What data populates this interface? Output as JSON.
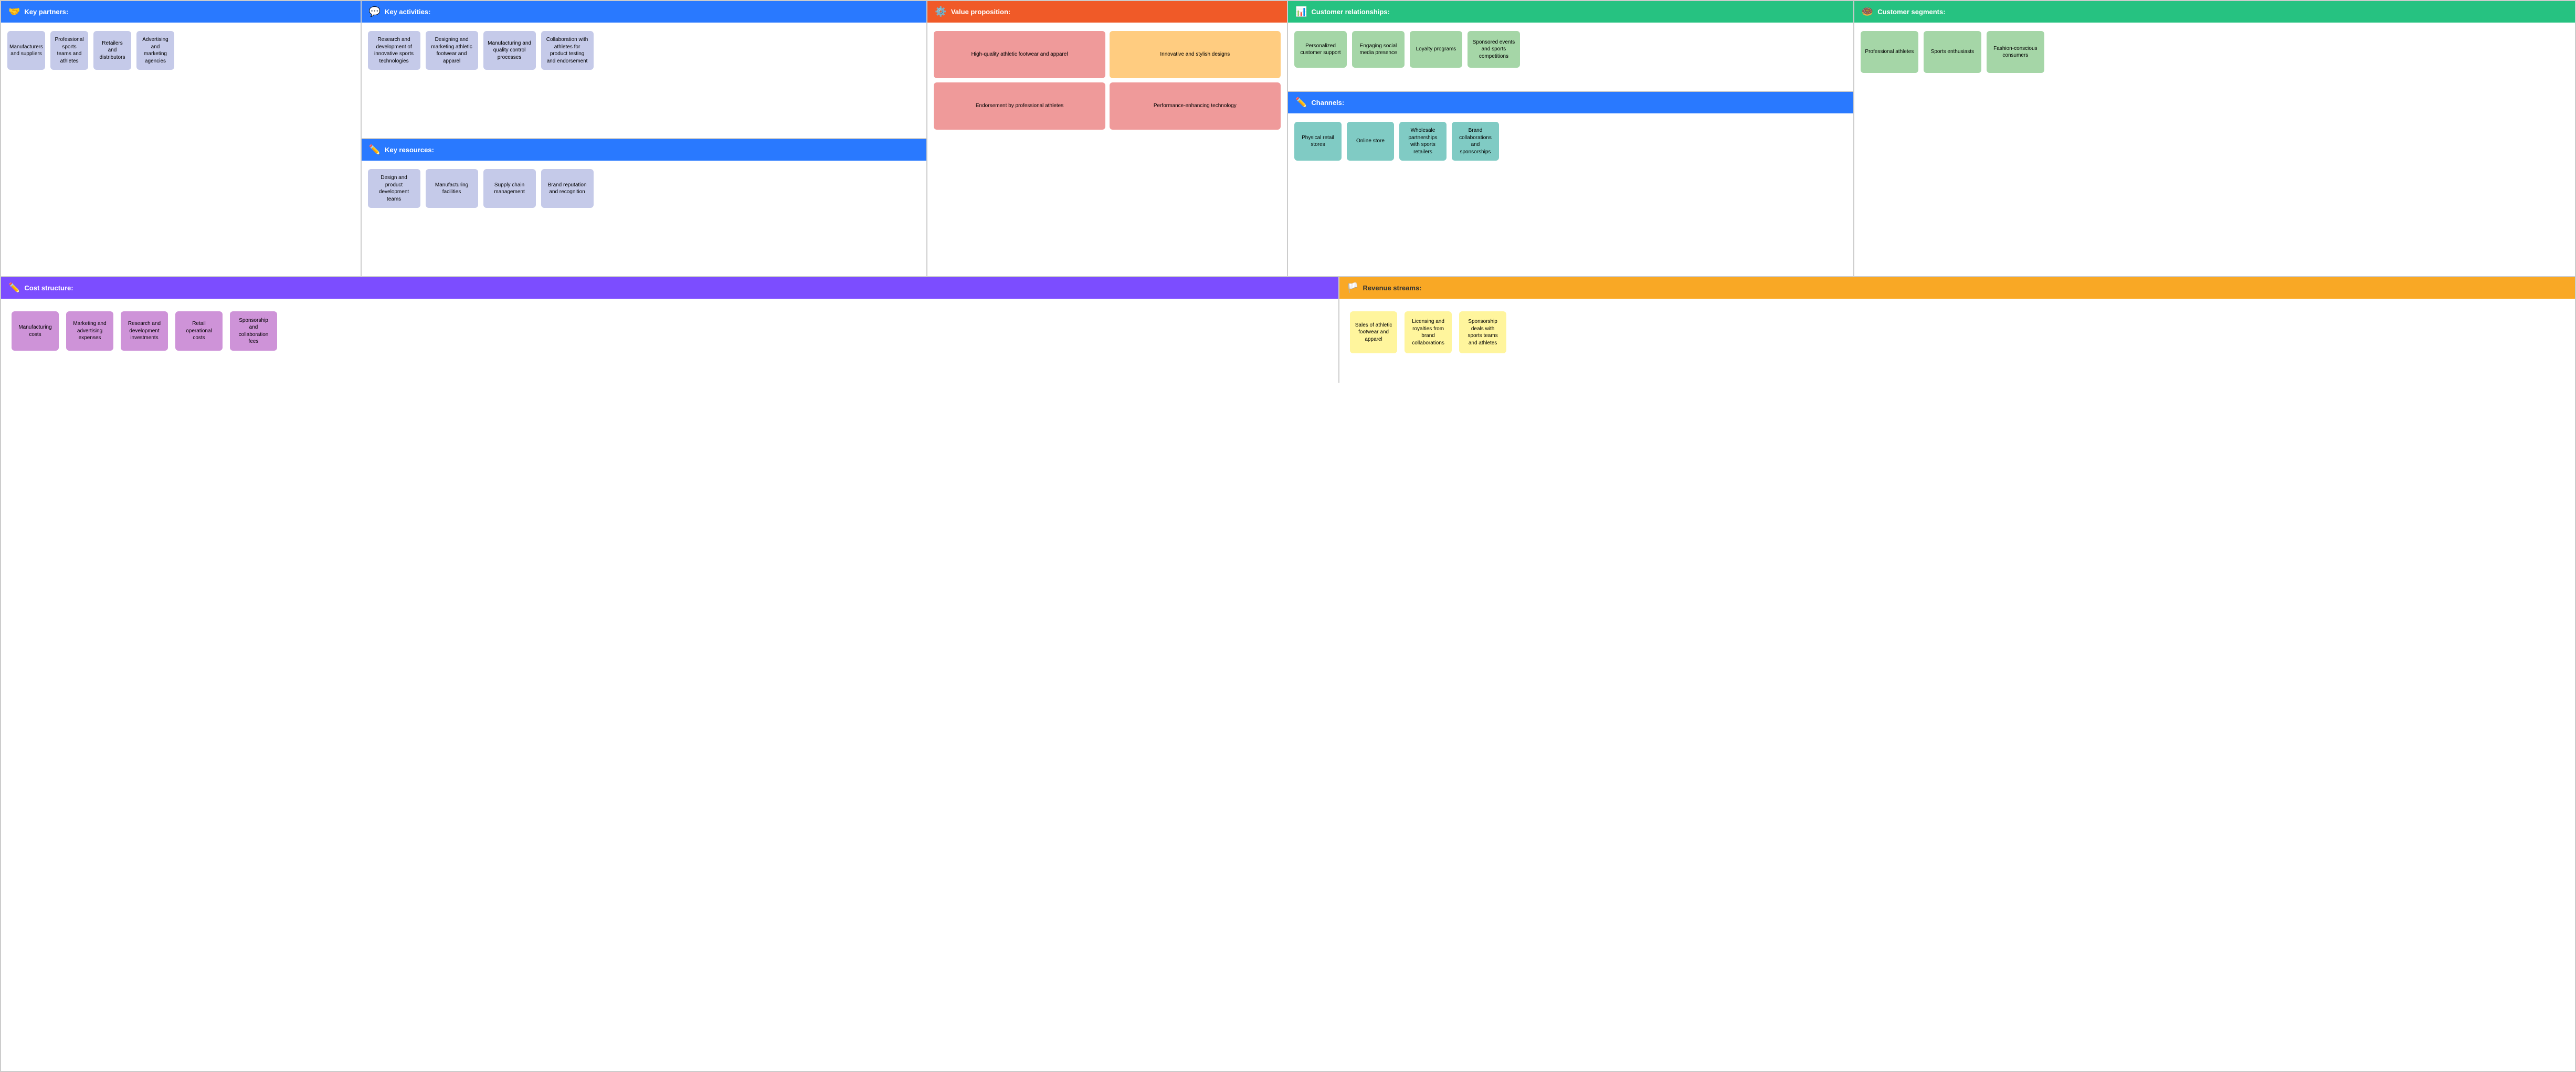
{
  "sections": {
    "key_partners": {
      "title": "Key partners:",
      "icon": "🤝",
      "cards": [
        "Manufacturers and suppliers",
        "Professional sports teams and athletes",
        "Retailers and distributors",
        "Advertising and marketing agencies"
      ]
    },
    "key_activities": {
      "title": "Key activities:",
      "icon": "💬",
      "cards": [
        "Research and development of innovative sports technologies",
        "Designing and marketing athletic footwear and apparel",
        "Manufacturing and quality control processes",
        "Collaboration with athletes for product testing and endorsement"
      ],
      "key_resources": {
        "title": "Key resources:",
        "icon": "✏️",
        "cards": [
          "Design and product development teams",
          "Manufacturing facilities",
          "Supply chain management",
          "Brand reputation and recognition"
        ]
      }
    },
    "value_proposition": {
      "title": "Value proposition:",
      "icon": "⚙️",
      "cards": [
        "High-quality athletic footwear and apparel",
        "Innovative and stylish designs",
        "Endorsement by professional athletes",
        "Performance-enhancing technology"
      ]
    },
    "customer_relationships": {
      "title": "Customer relationships:",
      "icon": "📊",
      "cards": [
        "Personalized customer support",
        "Engaging social media presence",
        "Loyalty programs",
        "Sponsored events and sports competitions"
      ],
      "channels": {
        "title": "Channels:",
        "icon": "✏️",
        "cards": [
          "Physical retail stores",
          "Online store",
          "Wholesale partnerships with sports retailers",
          "Brand collaborations and sponsorships"
        ]
      }
    },
    "customer_segments": {
      "title": "Customer segments:",
      "icon": "🍩",
      "cards": [
        "Professional athletes",
        "Sports enthusiasts",
        "Fashion-conscious consumers"
      ]
    },
    "cost_structure": {
      "title": "Cost structure:",
      "icon": "✏️",
      "cards": [
        "Manufacturing costs",
        "Marketing and advertising expenses",
        "Research and development investments",
        "Retail operational costs",
        "Sponsorship and collaboration fees"
      ]
    },
    "revenue_streams": {
      "title": "Revenue streams:",
      "icon": "🏳️",
      "cards": [
        "Sales of athletic footwear and apparel",
        "Licensing and royalties from brand collaborations",
        "Sponsorship deals with sports teams and athletes"
      ]
    }
  }
}
